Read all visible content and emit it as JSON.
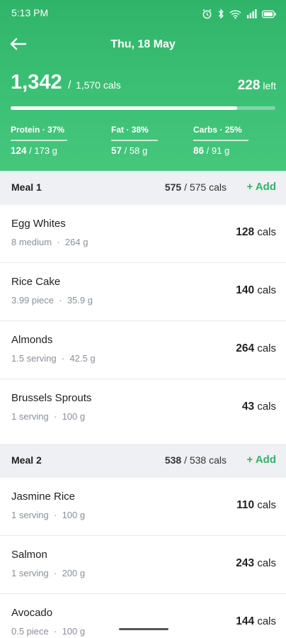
{
  "statusbar": {
    "time": "5:13 PM",
    "icons": [
      "alarm-icon",
      "bluetooth-icon",
      "wifi-icon",
      "signal-icon",
      "battery-icon"
    ]
  },
  "header": {
    "date": "Thu, 18 May",
    "consumed": "1,342",
    "slash": "/",
    "total": "1,570 cals",
    "left_value": "228",
    "left_label": "left",
    "progress_fraction": 0.855
  },
  "macros": [
    {
      "name": "Protein",
      "pct": "37%",
      "value": "124",
      "target": "/ 173 g"
    },
    {
      "name": "Fat",
      "pct": "38%",
      "value": "57",
      "target": "/ 58 g"
    },
    {
      "name": "Carbs",
      "pct": "25%",
      "value": "86",
      "target": "/ 91 g"
    }
  ],
  "meals": [
    {
      "name": "Meal 1",
      "cals": "575",
      "cals_total": "/ 575 cals",
      "add_label": "+ Add",
      "foods": [
        {
          "name": "Egg Whites",
          "qty": "8 medium",
          "weight": "264 g",
          "cals": "128",
          "unit": "cals"
        },
        {
          "name": "Rice Cake",
          "qty": "3.99 piece",
          "weight": "35.9 g",
          "cals": "140",
          "unit": "cals"
        },
        {
          "name": "Almonds",
          "qty": "1.5 serving",
          "weight": "42.5 g",
          "cals": "264",
          "unit": "cals"
        },
        {
          "name": "Brussels Sprouts",
          "qty": "1 serving",
          "weight": "100 g",
          "cals": "43",
          "unit": "cals"
        }
      ]
    },
    {
      "name": "Meal 2",
      "cals": "538",
      "cals_total": "/ 538 cals",
      "add_label": "+ Add",
      "foods": [
        {
          "name": "Jasmine Rice",
          "qty": "1 serving",
          "weight": "100 g",
          "cals": "110",
          "unit": "cals"
        },
        {
          "name": "Salmon",
          "qty": "1 serving",
          "weight": "200 g",
          "cals": "243",
          "unit": "cals"
        },
        {
          "name": "Avocado",
          "qty": "0.5 piece",
          "weight": "100 g",
          "cals": "144",
          "unit": "cals"
        }
      ]
    }
  ],
  "separator": "·",
  "colors": {
    "accent": "#2fb46a",
    "header_bg": "#3cc075",
    "section_bg": "#eef0f3"
  }
}
